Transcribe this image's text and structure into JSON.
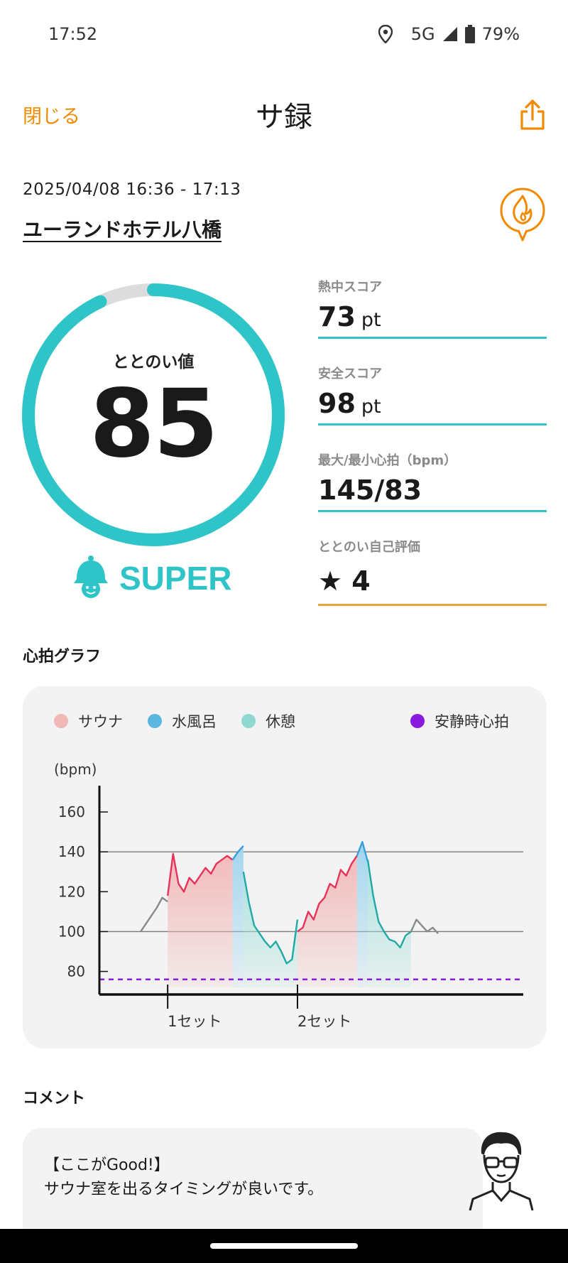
{
  "status_bar": {
    "time": "17:52",
    "network": "5G",
    "battery": "79%"
  },
  "nav": {
    "close_label": "閉じる",
    "title": "サ録",
    "share_icon": "share-icon"
  },
  "session": {
    "datetime": "2025/04/08 16:36 - 17:13",
    "facility": "ユーランドホテル八橋"
  },
  "gauge": {
    "label": "ととのい値",
    "value": "85",
    "fill_fraction": 0.93,
    "color": "#2ec4c8",
    "track_color": "#dcdcdc"
  },
  "rank": {
    "label": "SUPER",
    "icon": "bell-mascot-icon",
    "color": "#2ec4c8"
  },
  "metrics": [
    {
      "label": "熱中スコア",
      "value": "73",
      "unit": "pt",
      "line_color": "#2ec4c8"
    },
    {
      "label": "安全スコア",
      "value": "98",
      "unit": "pt",
      "line_color": "#2ec4c8"
    },
    {
      "label": "最大/最小心拍（bpm）",
      "value": "145/83",
      "unit": "",
      "line_color": "#2ec4c8"
    },
    {
      "label": "ととのい自己評価",
      "value": "★ 4",
      "unit": "",
      "line_color": "#e8a43c"
    }
  ],
  "heart_section": {
    "title": "心拍グラフ"
  },
  "legend": [
    {
      "label": "サウナ",
      "color": "#f2b7b7"
    },
    {
      "label": "水風呂",
      "color": "#5bb7e0"
    },
    {
      "label": "休憩",
      "color": "#8ed8d0"
    },
    {
      "label": "安静時心拍",
      "color": "#8a1ae0"
    }
  ],
  "chart_data": {
    "type": "line",
    "ylabel": "(bpm)",
    "yticks": [
      80,
      100,
      120,
      140,
      160
    ],
    "ylim": [
      72,
      170
    ],
    "xlim": [
      0,
      60
    ],
    "grid_lines": [
      100,
      140
    ],
    "resting_hr": 76,
    "set_labels": [
      {
        "label": "1セット",
        "x": 10
      },
      {
        "label": "2セット",
        "x": 34
      }
    ],
    "phases": [
      {
        "phase": "sauna",
        "start": 10,
        "end": 22
      },
      {
        "phase": "cold",
        "start": 22,
        "end": 24
      },
      {
        "phase": "rest",
        "start": 24,
        "end": 34
      },
      {
        "phase": "sauna",
        "start": 34,
        "end": 45
      },
      {
        "phase": "cold",
        "start": 45,
        "end": 47
      },
      {
        "phase": "rest",
        "start": 47,
        "end": 55
      }
    ],
    "series": [
      {
        "phase": "pre",
        "x": [
          5,
          6,
          7,
          8,
          9,
          10
        ],
        "y": [
          100,
          104,
          108,
          112,
          117,
          115
        ]
      },
      {
        "phase": "sauna",
        "x": [
          10,
          11,
          12,
          13,
          14,
          15,
          16,
          17,
          18,
          19,
          20,
          21,
          22
        ],
        "y": [
          118,
          139,
          124,
          120,
          127,
          124,
          128,
          132,
          129,
          134,
          136,
          138,
          136
        ]
      },
      {
        "phase": "cold",
        "x": [
          22,
          23,
          24
        ],
        "y": [
          136,
          140,
          143
        ]
      },
      {
        "phase": "rest",
        "x": [
          24,
          25,
          26,
          27,
          28,
          29,
          30,
          31,
          32,
          33,
          34
        ],
        "y": [
          130,
          115,
          103,
          99,
          95,
          92,
          95,
          90,
          84,
          86,
          106
        ]
      },
      {
        "phase": "sauna",
        "x": [
          34,
          35,
          36,
          37,
          38,
          39,
          40,
          41,
          42,
          43,
          44,
          45
        ],
        "y": [
          100,
          102,
          110,
          106,
          114,
          117,
          124,
          122,
          131,
          128,
          134,
          138
        ]
      },
      {
        "phase": "cold",
        "x": [
          45,
          46,
          47
        ],
        "y": [
          138,
          145,
          135
        ]
      },
      {
        "phase": "rest",
        "x": [
          47,
          48,
          49,
          50,
          51,
          52,
          53,
          54,
          55
        ],
        "y": [
          136,
          118,
          105,
          100,
          96,
          95,
          92,
          98,
          100
        ]
      },
      {
        "phase": "post",
        "x": [
          55,
          56,
          57,
          58,
          59,
          60
        ],
        "y": [
          100,
          106,
          103,
          100,
          102,
          99
        ]
      }
    ]
  },
  "comment_section": {
    "title": "コメント",
    "line1": "【ここがGood!】",
    "line2": "サウナ室を出るタイミングが良いです。"
  }
}
